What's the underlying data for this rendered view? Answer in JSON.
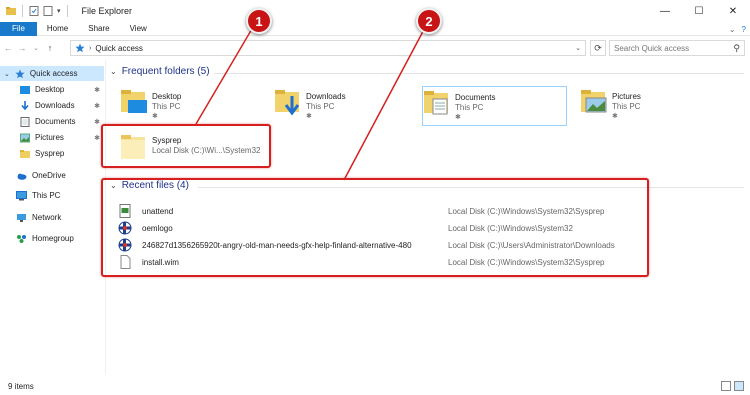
{
  "window": {
    "title": "File Explorer"
  },
  "ribbon": {
    "tabs": [
      "File",
      "Home",
      "Share",
      "View"
    ]
  },
  "address": {
    "path": "Quick access",
    "search_placeholder": "Search Quick access"
  },
  "nav": {
    "items": [
      {
        "label": "Quick access"
      },
      {
        "label": "Desktop"
      },
      {
        "label": "Downloads"
      },
      {
        "label": "Documents"
      },
      {
        "label": "Pictures"
      },
      {
        "label": "Sysprep"
      },
      {
        "label": "OneDrive"
      },
      {
        "label": "This PC"
      },
      {
        "label": "Network"
      },
      {
        "label": "Homegroup"
      }
    ]
  },
  "frequent": {
    "header": "Frequent folders (5)",
    "tiles": [
      {
        "name": "Desktop",
        "sub": "This PC"
      },
      {
        "name": "Downloads",
        "sub": "This PC"
      },
      {
        "name": "Documents",
        "sub": "This PC"
      },
      {
        "name": "Pictures",
        "sub": "This PC"
      },
      {
        "name": "Sysprep",
        "sub": "Local Disk (C:)\\Wi...\\System32"
      }
    ]
  },
  "recent": {
    "header": "Recent files (4)",
    "files": [
      {
        "name": "unattend",
        "location": "Local Disk (C:)\\Windows\\System32\\Sysprep"
      },
      {
        "name": "oemlogo",
        "location": "Local Disk (C:)\\Windows\\System32"
      },
      {
        "name": "246827d1356265920t-angry-old-man-needs-gfx-help-finland-alternative-480",
        "location": "Local Disk (C:)\\Users\\Administrator\\Downloads"
      },
      {
        "name": "install.wim",
        "location": "Local Disk (C:)\\Windows\\System32\\Sysprep"
      }
    ]
  },
  "status": {
    "items": "9 items"
  },
  "annotations": {
    "badge1": "1",
    "badge2": "2",
    "color": "#d61f1f"
  }
}
